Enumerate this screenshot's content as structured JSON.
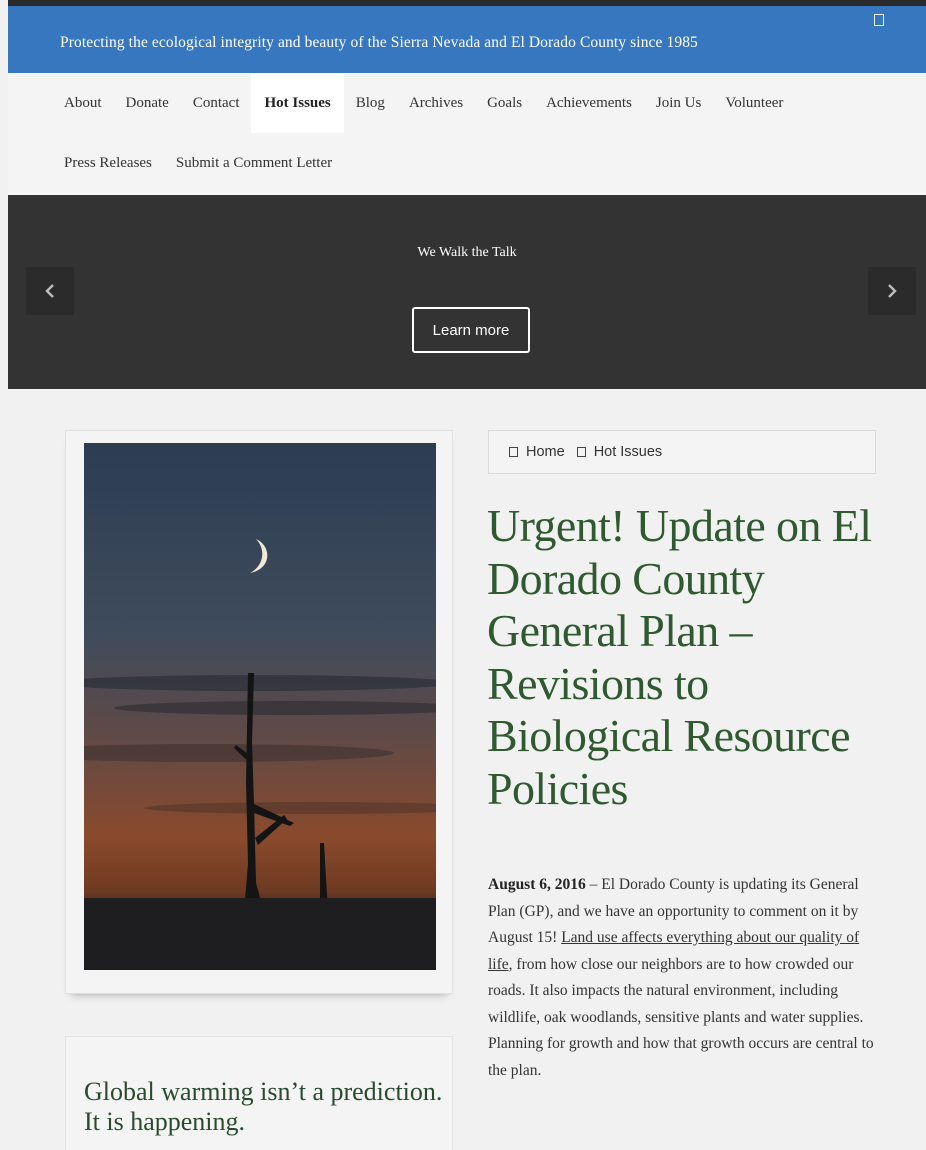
{
  "topbar": {
    "tagline": "Protecting the ecological integrity and beauty of the Sierra Nevada and El Dorado County since 1985",
    "icon": "square-icon"
  },
  "nav": {
    "row1": [
      "About",
      "Donate",
      "Contact",
      "Hot Issues",
      "Blog",
      "Archives",
      "Goals",
      "Achievements",
      "Join Us",
      "Volunteer"
    ],
    "row2": [
      "Press Releases",
      "Submit a Comment Letter"
    ],
    "active": "Hot Issues"
  },
  "hero": {
    "title": "We Walk the Talk",
    "button_label": "Learn more",
    "prev_icon": "chevron-left-icon",
    "next_icon": "chevron-right-icon",
    "background": "#333333"
  },
  "breadcrumb": {
    "home": "Home",
    "current": "Hot Issues"
  },
  "article": {
    "title": "Urgent!  Update on El Dorado County General Plan – Revisions to Biological Resource Policies",
    "date": "August 6, 2016",
    "text_before_link": " – El Dorado County is updating its General Plan (GP), and we have an opportunity to comment on it by August 15!  ",
    "link_text": "Land use affects everything about our quality of life,",
    "text_after_link": " from how close our neighbors are to how crowded our roads. It also impacts the natural environment, including wildlife, oak woodlands, sensitive plants and water supplies.  Planning for growth and how that growth occurs are central to the plan."
  },
  "sidebar": {
    "quote": "Global warming isn’t a prediction. It is happening."
  },
  "colors": {
    "topbar": "#3777c0",
    "headline": "#2f5a30",
    "hero": "#333333",
    "page_bg": "#f1f1f1"
  }
}
